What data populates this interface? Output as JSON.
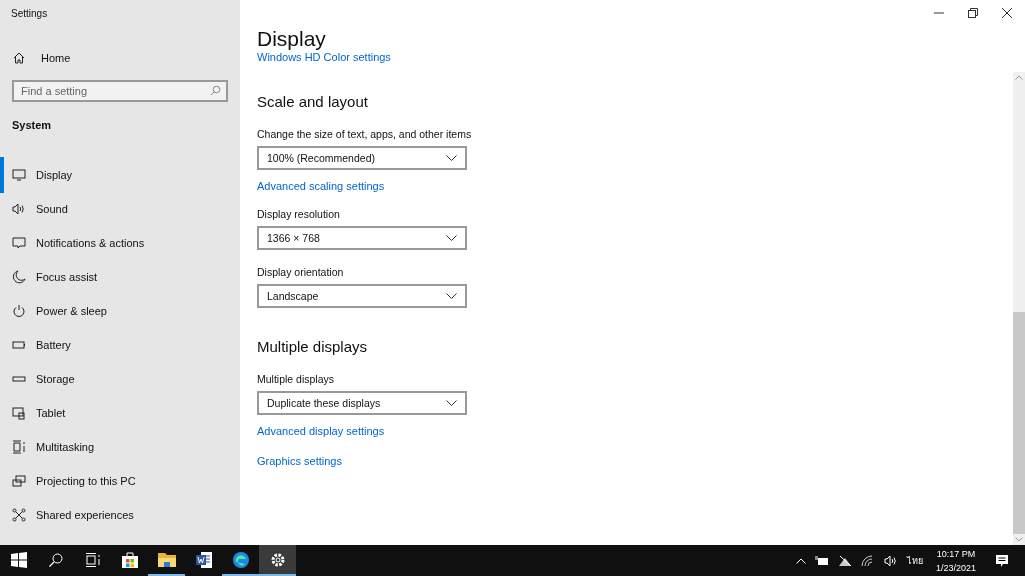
{
  "window": {
    "title": "Settings"
  },
  "sidebar": {
    "home": "Home",
    "search": {
      "placeholder": "Find a setting"
    },
    "section": "System",
    "items": [
      {
        "label": "Display",
        "selected": true
      },
      {
        "label": "Sound",
        "selected": false
      },
      {
        "label": "Notifications & actions",
        "selected": false
      },
      {
        "label": "Focus assist",
        "selected": false
      },
      {
        "label": "Power & sleep",
        "selected": false
      },
      {
        "label": "Battery",
        "selected": false
      },
      {
        "label": "Storage",
        "selected": false
      },
      {
        "label": "Tablet",
        "selected": false
      },
      {
        "label": "Multitasking",
        "selected": false
      },
      {
        "label": "Projecting to this PC",
        "selected": false
      },
      {
        "label": "Shared experiences",
        "selected": false
      }
    ]
  },
  "page": {
    "title": "Display",
    "content": [
      {
        "kind": "link",
        "text": "Windows HD Color settings"
      },
      {
        "kind": "heading",
        "text": "Scale and layout"
      },
      {
        "kind": "label",
        "text": "Change the size of text, apps, and other items"
      },
      {
        "kind": "dropdown",
        "text": "100% (Recommended)"
      },
      {
        "kind": "link",
        "text": "Advanced scaling settings"
      },
      {
        "kind": "label",
        "text": "Display resolution"
      },
      {
        "kind": "dropdown",
        "text": "1366 × 768"
      },
      {
        "kind": "label",
        "text": "Display orientation"
      },
      {
        "kind": "dropdown",
        "text": "Landscape"
      },
      {
        "kind": "heading",
        "text": "Multiple displays"
      },
      {
        "kind": "label",
        "text": "Multiple displays"
      },
      {
        "kind": "dropdown",
        "text": "Duplicate these displays"
      },
      {
        "kind": "link",
        "text": "Advanced display settings"
      },
      {
        "kind": "link",
        "text": "Graphics settings"
      }
    ]
  },
  "taskbar": {
    "apps": [
      {
        "running": false,
        "selected": false
      },
      {
        "running": false,
        "selected": false
      },
      {
        "running": false,
        "selected": false
      },
      {
        "running": false,
        "selected": false
      },
      {
        "running": true,
        "selected": false
      },
      {
        "running": false,
        "selected": false
      },
      {
        "running": true,
        "selected": false
      },
      {
        "running": true,
        "selected": true
      }
    ],
    "language": "ไทย",
    "time": "10:17 PM",
    "date": "1/23/2021"
  }
}
